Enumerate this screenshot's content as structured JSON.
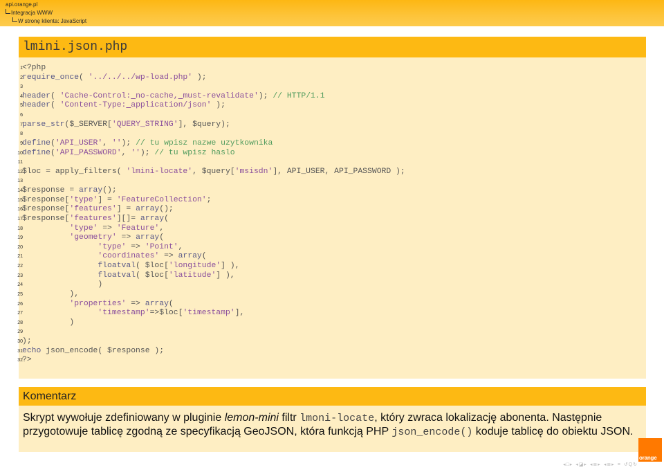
{
  "header": {
    "breadcrumbs": [
      "api.orange.pl",
      "Integracja WWW",
      "W stronę klienta: JavaScript"
    ]
  },
  "code_block": {
    "title": "lmini.json.php",
    "lines": [
      {
        "n": "1",
        "tokens": [
          {
            "t": "pl",
            "v": "<?php"
          }
        ]
      },
      {
        "n": "2",
        "tokens": [
          {
            "t": "kw",
            "v": "require_once"
          },
          {
            "t": "pl",
            "v": "( "
          },
          {
            "t": "str",
            "v": "'../../../wp-load.php'"
          },
          {
            "t": "pl",
            "v": " );"
          }
        ]
      },
      {
        "n": "3",
        "tokens": []
      },
      {
        "n": "4",
        "tokens": [
          {
            "t": "kw",
            "v": "header"
          },
          {
            "t": "pl",
            "v": "( "
          },
          {
            "t": "str",
            "v": "'Cache-Control:"
          },
          {
            "t": "sp",
            "v": " "
          },
          {
            "t": "str",
            "v": "no-cache,"
          },
          {
            "t": "sp",
            "v": " "
          },
          {
            "t": "str",
            "v": "must-revalidate'"
          },
          {
            "t": "pl",
            "v": "); "
          },
          {
            "t": "com",
            "v": "// HTTP/1.1"
          }
        ]
      },
      {
        "n": "5",
        "tokens": [
          {
            "t": "kw",
            "v": "header"
          },
          {
            "t": "pl",
            "v": "( "
          },
          {
            "t": "str",
            "v": "'Content-Type:"
          },
          {
            "t": "sp",
            "v": " "
          },
          {
            "t": "str",
            "v": "application/json'"
          },
          {
            "t": "pl",
            "v": " );"
          }
        ]
      },
      {
        "n": "6",
        "tokens": []
      },
      {
        "n": "7",
        "tokens": [
          {
            "t": "kw",
            "v": "parse_str"
          },
          {
            "t": "pl",
            "v": "($_SERVER["
          },
          {
            "t": "str",
            "v": "'QUERY_STRING'"
          },
          {
            "t": "pl",
            "v": "], $query);"
          }
        ]
      },
      {
        "n": "8",
        "tokens": []
      },
      {
        "n": "9",
        "tokens": [
          {
            "t": "kw",
            "v": "define"
          },
          {
            "t": "pl",
            "v": "("
          },
          {
            "t": "str",
            "v": "'API_USER'"
          },
          {
            "t": "pl",
            "v": ", "
          },
          {
            "t": "str",
            "v": "''"
          },
          {
            "t": "pl",
            "v": "); "
          },
          {
            "t": "com",
            "v": "// tu wpisz nazwe uzytkownika"
          }
        ]
      },
      {
        "n": "10",
        "tokens": [
          {
            "t": "kw",
            "v": "define"
          },
          {
            "t": "pl",
            "v": "("
          },
          {
            "t": "str",
            "v": "'API_PASSWORD'"
          },
          {
            "t": "pl",
            "v": ", "
          },
          {
            "t": "str",
            "v": "''"
          },
          {
            "t": "pl",
            "v": "); "
          },
          {
            "t": "com",
            "v": "// tu wpisz haslo"
          }
        ]
      },
      {
        "n": "11",
        "tokens": []
      },
      {
        "n": "12",
        "tokens": [
          {
            "t": "pl",
            "v": "$loc = apply_filters( "
          },
          {
            "t": "str",
            "v": "'lmini-locate'"
          },
          {
            "t": "pl",
            "v": ", $query["
          },
          {
            "t": "str",
            "v": "'msisdn'"
          },
          {
            "t": "pl",
            "v": "], API_USER, API_PASSWORD );"
          }
        ]
      },
      {
        "n": "13",
        "tokens": []
      },
      {
        "n": "14",
        "tokens": [
          {
            "t": "pl",
            "v": "$response = "
          },
          {
            "t": "kw",
            "v": "array"
          },
          {
            "t": "pl",
            "v": "();"
          }
        ]
      },
      {
        "n": "15",
        "tokens": [
          {
            "t": "pl",
            "v": "$response["
          },
          {
            "t": "str",
            "v": "'type'"
          },
          {
            "t": "pl",
            "v": "] = "
          },
          {
            "t": "str",
            "v": "'FeatureCollection'"
          },
          {
            "t": "pl",
            "v": ";"
          }
        ]
      },
      {
        "n": "16",
        "tokens": [
          {
            "t": "pl",
            "v": "$response["
          },
          {
            "t": "str",
            "v": "'features'"
          },
          {
            "t": "pl",
            "v": "] = "
          },
          {
            "t": "kw",
            "v": "array"
          },
          {
            "t": "pl",
            "v": "();"
          }
        ]
      },
      {
        "n": "17",
        "tokens": [
          {
            "t": "pl",
            "v": "$response["
          },
          {
            "t": "str",
            "v": "'features'"
          },
          {
            "t": "pl",
            "v": "][]= "
          },
          {
            "t": "kw",
            "v": "array"
          },
          {
            "t": "pl",
            "v": "("
          }
        ]
      },
      {
        "n": "18",
        "tokens": [
          {
            "t": "pl",
            "v": "          "
          },
          {
            "t": "str",
            "v": "'type'"
          },
          {
            "t": "pl",
            "v": " => "
          },
          {
            "t": "str",
            "v": "'Feature'"
          },
          {
            "t": "pl",
            "v": ","
          }
        ]
      },
      {
        "n": "19",
        "tokens": [
          {
            "t": "pl",
            "v": "          "
          },
          {
            "t": "str",
            "v": "'geometry'"
          },
          {
            "t": "pl",
            "v": " => "
          },
          {
            "t": "kw",
            "v": "array"
          },
          {
            "t": "pl",
            "v": "("
          }
        ]
      },
      {
        "n": "20",
        "tokens": [
          {
            "t": "pl",
            "v": "                "
          },
          {
            "t": "str",
            "v": "'type'"
          },
          {
            "t": "pl",
            "v": " => "
          },
          {
            "t": "str",
            "v": "'Point'"
          },
          {
            "t": "pl",
            "v": ","
          }
        ]
      },
      {
        "n": "21",
        "tokens": [
          {
            "t": "pl",
            "v": "                "
          },
          {
            "t": "str",
            "v": "'coordinates'"
          },
          {
            "t": "pl",
            "v": " => "
          },
          {
            "t": "kw",
            "v": "array"
          },
          {
            "t": "pl",
            "v": "("
          }
        ]
      },
      {
        "n": "22",
        "tokens": [
          {
            "t": "pl",
            "v": "                "
          },
          {
            "t": "kw",
            "v": "floatval"
          },
          {
            "t": "pl",
            "v": "( $loc["
          },
          {
            "t": "str",
            "v": "'longitude'"
          },
          {
            "t": "pl",
            "v": "] ),"
          }
        ]
      },
      {
        "n": "23",
        "tokens": [
          {
            "t": "pl",
            "v": "                "
          },
          {
            "t": "kw",
            "v": "floatval"
          },
          {
            "t": "pl",
            "v": "( $loc["
          },
          {
            "t": "str",
            "v": "'latitude'"
          },
          {
            "t": "pl",
            "v": "] ),"
          }
        ]
      },
      {
        "n": "24",
        "tokens": [
          {
            "t": "pl",
            "v": "                )"
          }
        ]
      },
      {
        "n": "25",
        "tokens": [
          {
            "t": "pl",
            "v": "          ),"
          }
        ]
      },
      {
        "n": "26",
        "tokens": [
          {
            "t": "pl",
            "v": "          "
          },
          {
            "t": "str",
            "v": "'properties'"
          },
          {
            "t": "pl",
            "v": " => "
          },
          {
            "t": "kw",
            "v": "array"
          },
          {
            "t": "pl",
            "v": "("
          }
        ]
      },
      {
        "n": "27",
        "tokens": [
          {
            "t": "pl",
            "v": "                "
          },
          {
            "t": "str",
            "v": "'timestamp'"
          },
          {
            "t": "pl",
            "v": "=>$loc["
          },
          {
            "t": "str",
            "v": "'timestamp'"
          },
          {
            "t": "pl",
            "v": "],"
          }
        ]
      },
      {
        "n": "28",
        "tokens": [
          {
            "t": "pl",
            "v": "          )"
          }
        ]
      },
      {
        "n": "29",
        "tokens": []
      },
      {
        "n": "30",
        "tokens": [
          {
            "t": "pl",
            "v": ");"
          }
        ]
      },
      {
        "n": "31",
        "tokens": [
          {
            "t": "kw",
            "v": "echo"
          },
          {
            "t": "pl",
            "v": " json_encode( $response );"
          }
        ]
      },
      {
        "n": "32",
        "tokens": [
          {
            "t": "pl",
            "v": "?>"
          }
        ]
      }
    ]
  },
  "comment_block": {
    "title": "Komentarz",
    "segments": [
      {
        "style": "text",
        "v": "Skrypt wywołuje zdefiniowany w pluginie "
      },
      {
        "style": "em",
        "v": "lemon-mini"
      },
      {
        "style": "text",
        "v": " filtr "
      },
      {
        "style": "mono",
        "v": "lmoni-locate"
      },
      {
        "style": "text",
        "v": ", który zwraca lokalizację abonenta. Następnie przygotowuje tablicę zgodną ze specyfikacją GeoJSON, która funkcją PHP "
      },
      {
        "style": "mono",
        "v": "json_encode()"
      },
      {
        "style": "text",
        "v": " koduje tablicę do obiektu JSON."
      }
    ]
  },
  "logo": {
    "text": "orange",
    "color": "#ff7900"
  },
  "colors": {
    "accent": "#fdb913",
    "block_bg": "#feeec3"
  },
  "nav_controls": [
    "first-frame",
    "prev-frame",
    "prev-subsection",
    "next-subsection",
    "prev-section",
    "next-section",
    "align",
    "search"
  ]
}
